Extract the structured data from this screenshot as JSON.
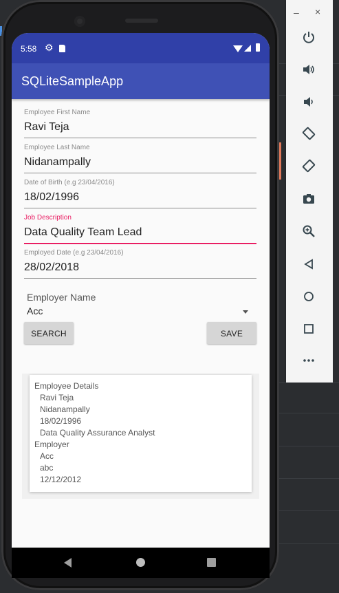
{
  "status_bar": {
    "time": "5:58",
    "icons": [
      "gear-icon",
      "sd-card-icon",
      "wifi-icon",
      "signal-icon",
      "battery-icon"
    ]
  },
  "app_bar": {
    "title": "SQLiteSampleApp"
  },
  "form": {
    "first_name": {
      "label": "Employee First Name",
      "value": "Ravi Teja"
    },
    "last_name": {
      "label": "Employee Last Name",
      "value": "Nidanampally"
    },
    "dob": {
      "label": "Date of Birth (e.g 23/04/2016)",
      "value": "18/02/1996"
    },
    "job": {
      "label": "Job Description",
      "value": "Data Quality Team Lead"
    },
    "employed_date": {
      "label": "Employed Date (e.g 23/04/2016)",
      "value": "28/02/2018"
    },
    "employer": {
      "label": "Employer Name",
      "value": "Acc"
    }
  },
  "buttons": {
    "search": "SEARCH",
    "save": "SAVE"
  },
  "details": {
    "lines": [
      "Employee Details",
      "Ravi Teja",
      "Nidanampally",
      "18/02/1996",
      "Data Quality Assurance Analyst",
      "Employer",
      "Acc",
      "abc",
      "12/12/2012"
    ]
  },
  "colors": {
    "primary": "#3f51b5",
    "primary_dark": "#3040a8",
    "accent": "#e91e63"
  },
  "emulator_toolbar": {
    "window_controls": [
      "minimize-icon",
      "close-icon"
    ],
    "minimize": "–",
    "close": "×",
    "buttons": [
      "power-icon",
      "volume-up-icon",
      "volume-down-icon",
      "rotate-left-icon",
      "rotate-right-icon",
      "camera-icon",
      "zoom-icon",
      "back-icon",
      "home-icon",
      "overview-icon",
      "more-icon"
    ]
  }
}
